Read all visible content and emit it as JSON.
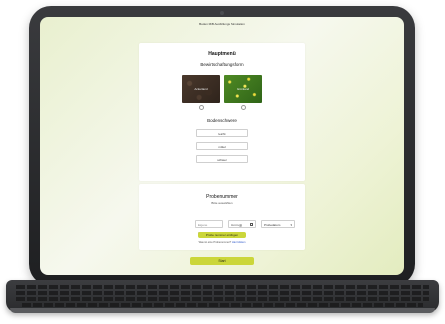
{
  "app": {
    "title": "Boden MiB Ausfüllungs Simulation"
  },
  "top_card": {
    "heading": "Hauptmenü",
    "cultivation": {
      "label": "Bewirtschaftungsform",
      "options": [
        {
          "label": "Ackerland",
          "selected": false
        },
        {
          "label": "Grünland",
          "selected": false
        }
      ]
    },
    "soil": {
      "label": "Bodenschwere",
      "options": [
        "leicht",
        "mittel",
        "schwer"
      ]
    }
  },
  "bottom_card": {
    "heading": "Probenummer",
    "subtitle": "Bitte auswählen",
    "id_placeholder": "Eigene Kundennr./Lab",
    "date_value": "tt.mm.jjjj",
    "select_value": "Probedatum",
    "add_button": "Probe nummer einfügen",
    "footer_prefix": "Was ist eine Probenummer?",
    "footer_link": "Hier klicken"
  },
  "main_button": "Start",
  "colors": {
    "accent": "#cbd63a",
    "link": "#2a55c8"
  }
}
